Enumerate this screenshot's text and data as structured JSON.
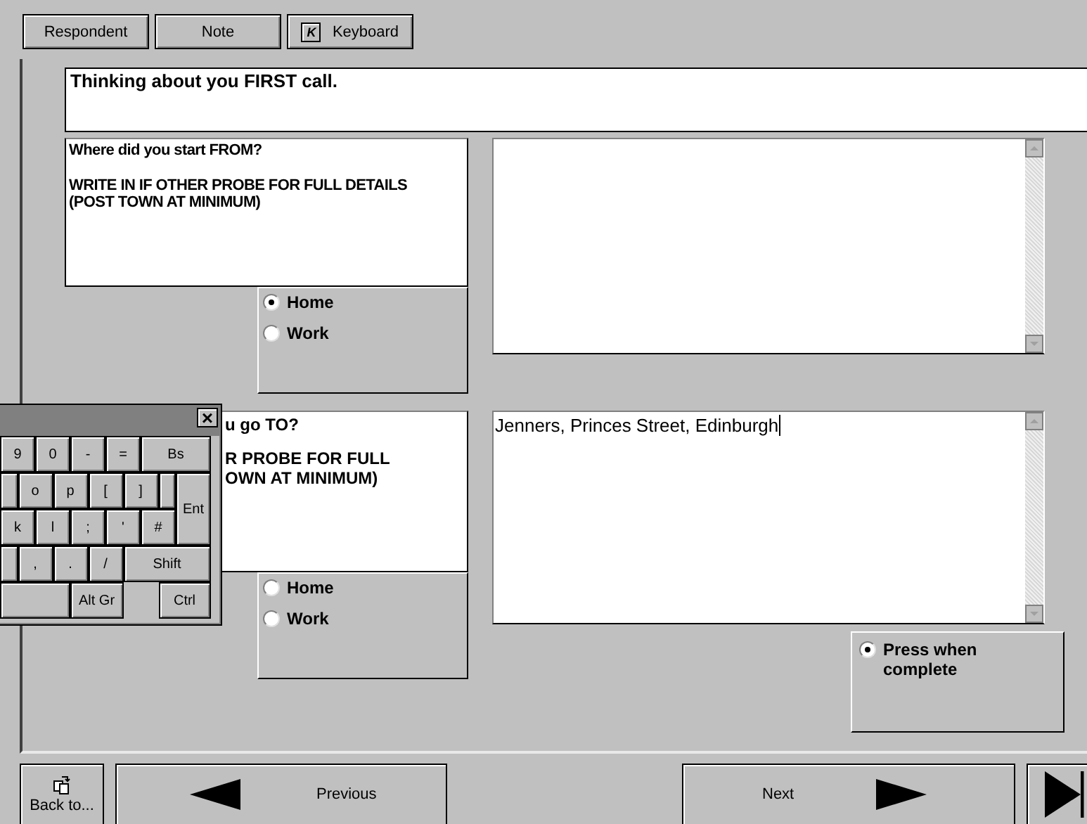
{
  "toolbar": {
    "buttons": [
      {
        "label": "Respondent",
        "kind": "text"
      },
      {
        "label": "Note",
        "kind": "text"
      },
      {
        "label": "Keyboard",
        "kind": "keycap",
        "glyph": "K"
      }
    ]
  },
  "header": {
    "text": "Thinking about you FIRST call."
  },
  "questions": [
    {
      "prompt": "Where did you start FROM?",
      "instructions": [
        "WRITE IN IF OTHER PROBE FOR FULL DETAILS",
        "(POST TOWN AT MINIMUM)"
      ],
      "options": [
        {
          "label": "Home",
          "selected": true
        },
        {
          "label": "Work",
          "selected": false
        }
      ]
    },
    {
      "prompt": "u go TO?",
      "instructions": [
        "R PROBE FOR FULL",
        "OWN AT MINIMUM)"
      ],
      "options": [
        {
          "label": "Home",
          "selected": false
        },
        {
          "label": "Work",
          "selected": false
        }
      ],
      "answer": "Jenners, Princes Street, Edinburgh",
      "focused": true
    }
  ],
  "complete": {
    "label": "Press when complete",
    "selected": true
  },
  "keyboard": {
    "close": "×",
    "rows": [
      [
        "9",
        "0",
        "-",
        "=",
        "Bs"
      ],
      [
        "",
        "o",
        "p",
        "[",
        "]",
        "",
        "Ent"
      ],
      [
        "k",
        "l",
        ";",
        "'",
        "#"
      ],
      [
        "",
        ",",
        ".",
        "/",
        "Shift"
      ],
      [
        "",
        "Alt Gr",
        "Ctrl"
      ]
    ]
  },
  "nav": {
    "back": "Back to...",
    "previous": "Previous",
    "next": "Next"
  }
}
